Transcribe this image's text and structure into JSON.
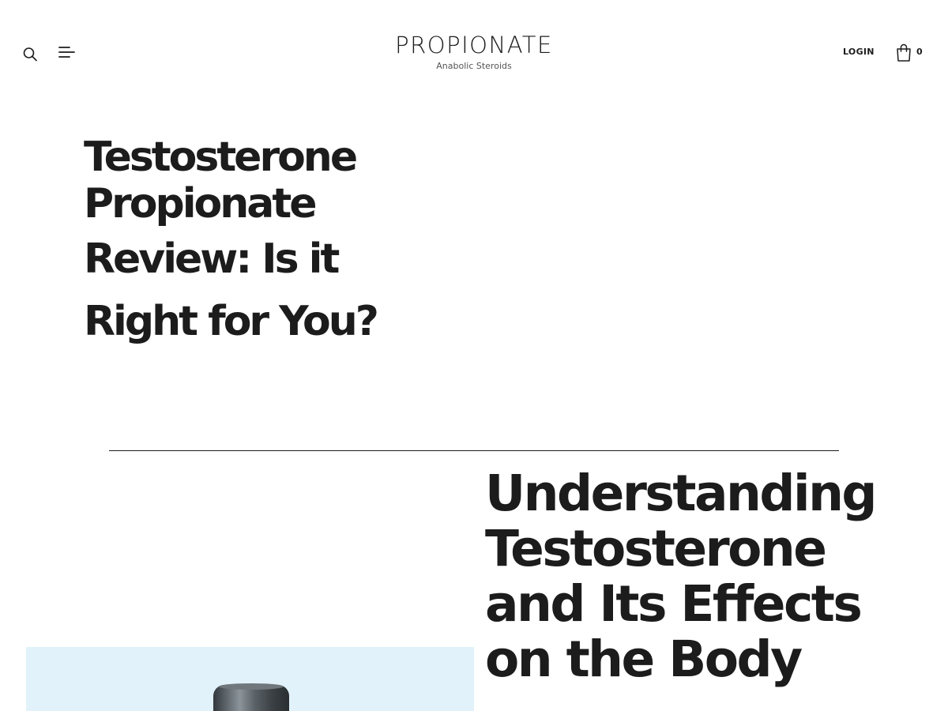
{
  "header": {
    "brand": "PROPIONATE",
    "tagline": "Anabolic Steroids",
    "login_label": "LOGIN",
    "cart_count": "0",
    "icons": [
      "search-icon",
      "menu-icon",
      "shopping-bag-icon"
    ]
  },
  "hero": {
    "title_line1": "Testosterone Propionate",
    "title_line2": "Review: Is it Right for You?"
  },
  "section": {
    "heading": "Understanding Testosterone and Its Effects on the Body"
  },
  "colors": {
    "text": "#1c1c1c",
    "background": "#ffffff",
    "image_background": "#e1f2fb"
  }
}
